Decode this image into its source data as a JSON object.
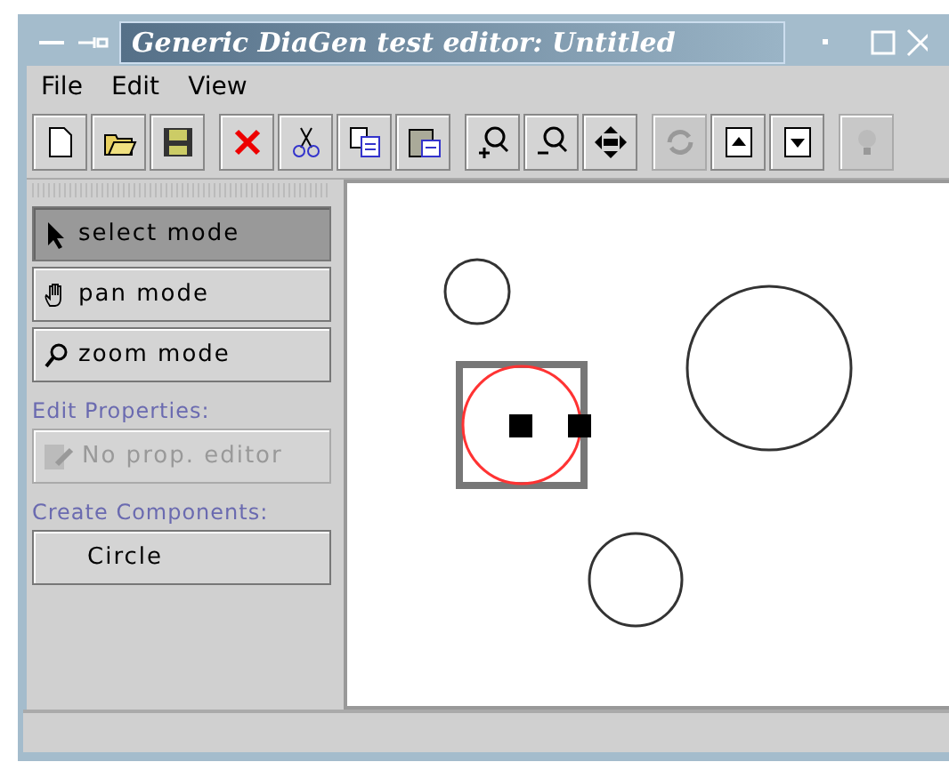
{
  "window": {
    "title": "Generic DiaGen test editor: Untitled"
  },
  "menu": [
    "File",
    "Edit",
    "View"
  ],
  "toolbar": [
    {
      "kind": "new",
      "disabled": false
    },
    {
      "kind": "open",
      "disabled": false
    },
    {
      "kind": "save",
      "disabled": false
    },
    {
      "kind": "delete",
      "disabled": false
    },
    {
      "kind": "cut",
      "disabled": false
    },
    {
      "kind": "copy",
      "disabled": false
    },
    {
      "kind": "paste",
      "disabled": false
    },
    {
      "kind": "zoomin",
      "disabled": false
    },
    {
      "kind": "zoomout",
      "disabled": false
    },
    {
      "kind": "fit",
      "disabled": false
    },
    {
      "kind": "refresh",
      "disabled": true
    },
    {
      "kind": "up",
      "disabled": false
    },
    {
      "kind": "down",
      "disabled": false
    },
    {
      "kind": "bulb",
      "disabled": true
    }
  ],
  "modes": [
    {
      "kind": "select",
      "label": "select mode",
      "selected": true
    },
    {
      "kind": "pan",
      "label": "pan mode",
      "selected": false
    },
    {
      "kind": "zoom",
      "label": "zoom mode",
      "selected": false
    }
  ],
  "edit_properties": {
    "heading": "Edit Properties:",
    "button": "No prop. editor",
    "disabled": true
  },
  "create_components": {
    "heading": "Create Components:",
    "buttons": [
      "Circle"
    ]
  },
  "canvas": {
    "circles": [
      {
        "selected": false
      },
      {
        "selected": true
      },
      {
        "selected": false
      },
      {
        "selected": false
      }
    ]
  }
}
